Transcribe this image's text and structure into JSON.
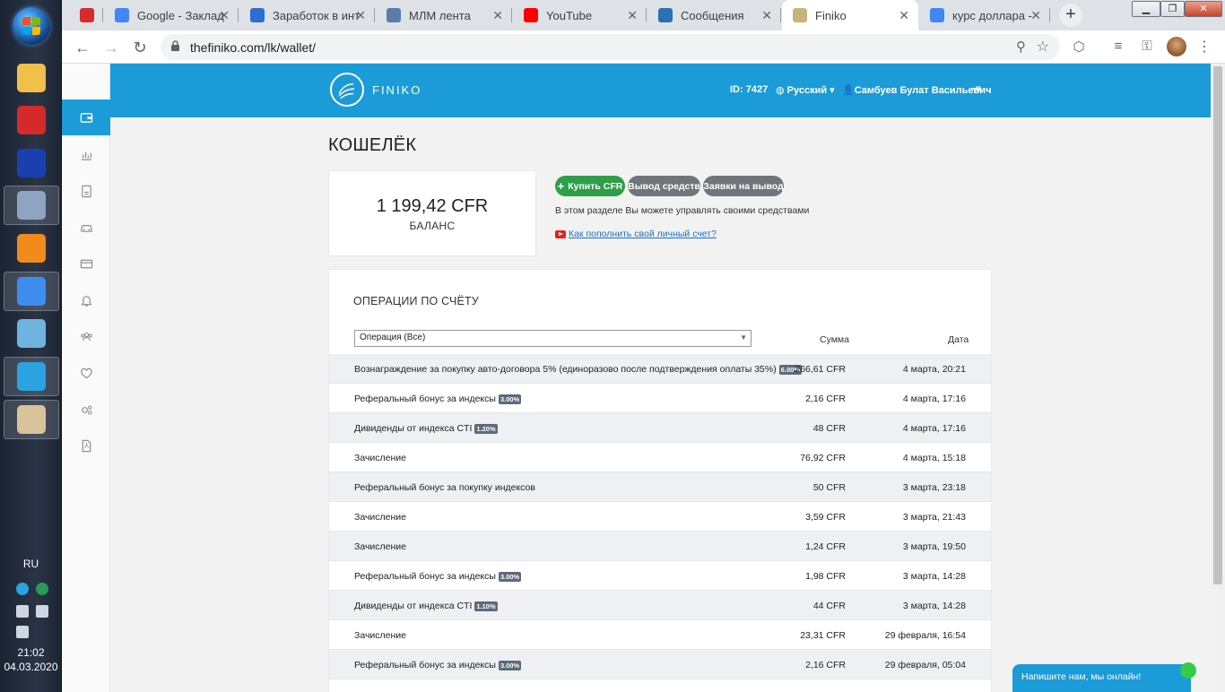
{
  "taskbar": {
    "apps": [
      {
        "name": "file-manager",
        "color": "#f0c04a"
      },
      {
        "name": "red-app",
        "color": "#d42a2a"
      },
      {
        "name": "save-app",
        "color": "#1a3fb0"
      },
      {
        "name": "calculator",
        "color": "#8fa4c0"
      },
      {
        "name": "media-player",
        "color": "#f28a1d"
      },
      {
        "name": "chrome",
        "color": "#3f8cf0"
      },
      {
        "name": "notes",
        "color": "#6fb4e0"
      },
      {
        "name": "telegram",
        "color": "#2aa3e0"
      },
      {
        "name": "paint",
        "color": "#d8c39a"
      }
    ],
    "lang": "RU",
    "time": "21:02",
    "date": "04.03.2020"
  },
  "browser": {
    "tabs": [
      {
        "title": "",
        "fav_color": "#d82c2c"
      },
      {
        "title": "Google - Заклад",
        "fav_color": "#4285f4"
      },
      {
        "title": "Заработок в инт",
        "fav_color": "#2b6fd0"
      },
      {
        "title": "МЛМ лента",
        "fav_color": "#5a7ea8"
      },
      {
        "title": "YouTube",
        "fav_color": "#ff0000"
      },
      {
        "title": "Сообщения",
        "fav_color": "#2c6fb6"
      },
      {
        "title": "Finiko",
        "fav_color": "#c8b27a"
      },
      {
        "title": "курс доллара -",
        "fav_color": "#4285f4"
      }
    ],
    "active_tab": 6,
    "url": "thefiniko.com/lk/wallet/"
  },
  "header": {
    "logo_text": "FINIKO",
    "id_label": "ID: 7427",
    "language": "Русский",
    "user": "Самбуев Булат Васильевич"
  },
  "wallet": {
    "title": "КОШЕЛЁК",
    "balance": "1 199,42 CFR",
    "balance_label": "БАЛАНС",
    "buttons": {
      "buy": "Купить CFR",
      "withdraw": "Вывод средств",
      "requests": "Заявки на вывод"
    },
    "info_text": "В этом разделе Вы можете управлять своими средствами",
    "help_link": "Как пополнить свой личный счет?"
  },
  "operations": {
    "title": "ОПЕРАЦИИ ПО СЧЁТУ",
    "filter_value": "Операция (Все)",
    "col_sum": "Сумма",
    "col_date": "Дата",
    "rows": [
      {
        "desc": "Вознаграждение за покупку авто-договора 5% (единоразово после подтверждения оплаты 35%)",
        "badge": "6.00%",
        "sum": "266,61 CFR",
        "date": "4 марта, 20:21"
      },
      {
        "desc": "Реферальный бонус за индексы",
        "badge": "3.00%",
        "sum": "2,16 CFR",
        "date": "4 марта, 17:16"
      },
      {
        "desc": "Дивиденды от индекса CTI",
        "badge": "1.20%",
        "sum": "48 CFR",
        "date": "4 марта, 17:16"
      },
      {
        "desc": "Зачисление",
        "badge": "",
        "sum": "76,92 CFR",
        "date": "4 марта, 15:18"
      },
      {
        "desc": "Реферальный бонус за покупку индексов",
        "badge": "",
        "sum": "50 CFR",
        "date": "3 марта, 23:18"
      },
      {
        "desc": "Зачисление",
        "badge": "",
        "sum": "3,59 CFR",
        "date": "3 марта, 21:43"
      },
      {
        "desc": "Зачисление",
        "badge": "",
        "sum": "1,24 CFR",
        "date": "3 марта, 19:50"
      },
      {
        "desc": "Реферальный бонус за индексы",
        "badge": "3.00%",
        "sum": "1,98 CFR",
        "date": "3 марта, 14:28"
      },
      {
        "desc": "Дивиденды от индекса CTI",
        "badge": "1.10%",
        "sum": "44 CFR",
        "date": "3 марта, 14:28"
      },
      {
        "desc": "Зачисление",
        "badge": "",
        "sum": "23,31 CFR",
        "date": "29 февраля, 16:54"
      },
      {
        "desc": "Реферальный бонус за индексы",
        "badge": "3.00%",
        "sum": "2,16 CFR",
        "date": "29 февраля, 05:04"
      }
    ]
  },
  "chat": {
    "label": "Напишите нам, мы онлайн!"
  },
  "colors": {
    "primary": "#1b9bd7",
    "green": "#2e9e48",
    "gray_btn": "#6f757b"
  }
}
